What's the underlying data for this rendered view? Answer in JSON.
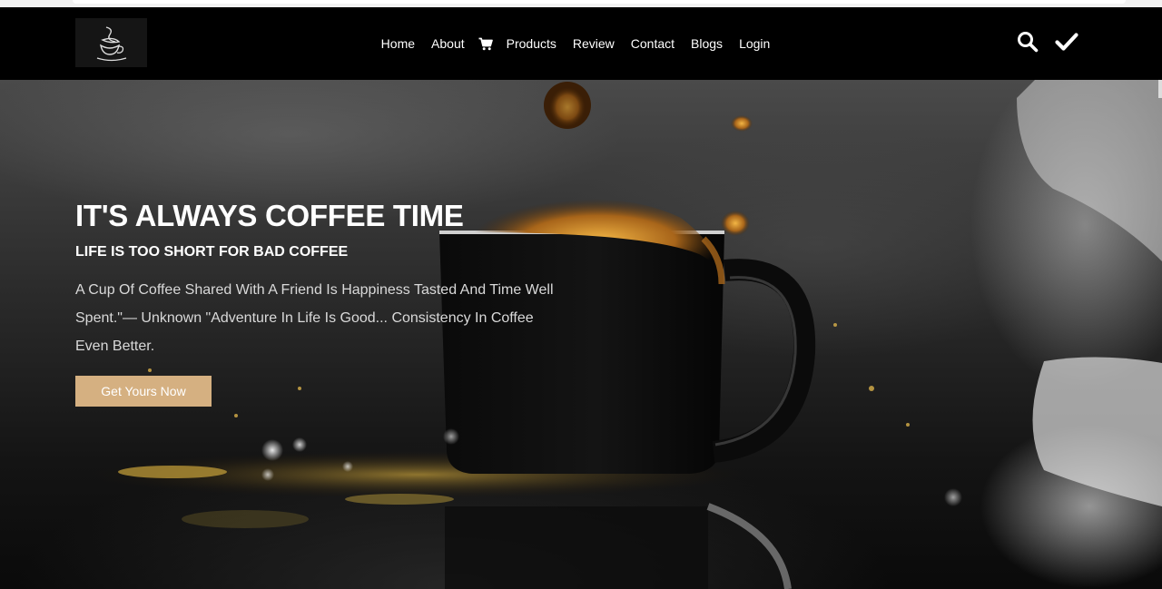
{
  "brand": {
    "logo_icon": "coffee-cup-logo-icon"
  },
  "nav": {
    "items": [
      {
        "label": "Home"
      },
      {
        "label": "About"
      },
      {
        "label": "Products"
      },
      {
        "label": "Review"
      },
      {
        "label": "Contact"
      },
      {
        "label": "Blogs"
      },
      {
        "label": "Login"
      }
    ],
    "cart_icon": "shopping-cart-icon",
    "search_icon": "search-icon",
    "check_icon": "check-icon"
  },
  "hero": {
    "title": "IT'S ALWAYS COFFEE TIME",
    "subtitle": "LIFE IS TOO SHORT FOR BAD COFFEE",
    "description": "A Cup Of Coffee Shared With A Friend Is Happiness Tasted And Time Well Spent.\"— Unknown \"Adventure In Life Is Good... Consistency In Coffee Even Better.",
    "cta_label": "Get Yours Now",
    "accent_color": "#d5b081"
  }
}
